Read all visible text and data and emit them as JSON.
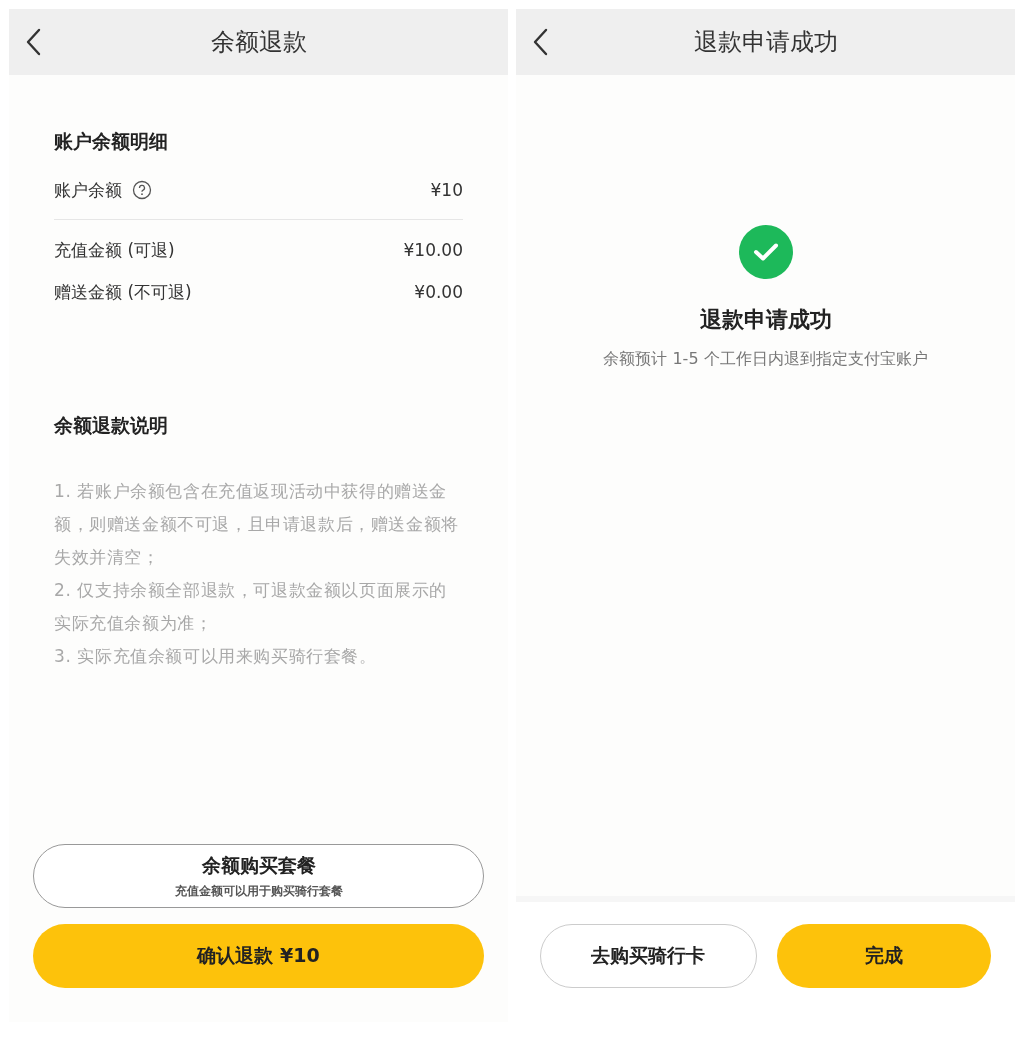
{
  "refund_page": {
    "title": "余额退款",
    "balance_section": {
      "title": "账户余额明细",
      "total": {
        "label": "账户余额",
        "value": "¥10"
      },
      "rows": [
        {
          "label": "充值金额 (可退)",
          "value": "¥10.00"
        },
        {
          "label": "赠送金额 (不可退)",
          "value": "¥0.00"
        }
      ]
    },
    "notes_section": {
      "title": "余额退款说明",
      "items": [
        "1. 若账户余额包含在充值返现活动中获得的赠送金额，则赠送金额不可退，且申请退款后，赠送金额将失效并清空；",
        "2. 仅支持余额全部退款，可退款金额以页面展示的实际充值余额为准；",
        "3. 实际充值余额可以用来购买骑行套餐。"
      ]
    },
    "buy_button": {
      "label": "余额购买套餐",
      "sublabel": "充值金额可以用于购买骑行套餐"
    },
    "confirm_button": {
      "label": "确认退款 ¥10"
    }
  },
  "success_page": {
    "title": "退款申请成功",
    "heading": "退款申请成功",
    "message": "余额预计 1-5 个工作日内退到指定支付宝账户",
    "buttons": [
      {
        "label": "去购买骑行卡",
        "kind": "outline"
      },
      {
        "label": "完成",
        "kind": "primary"
      }
    ]
  }
}
